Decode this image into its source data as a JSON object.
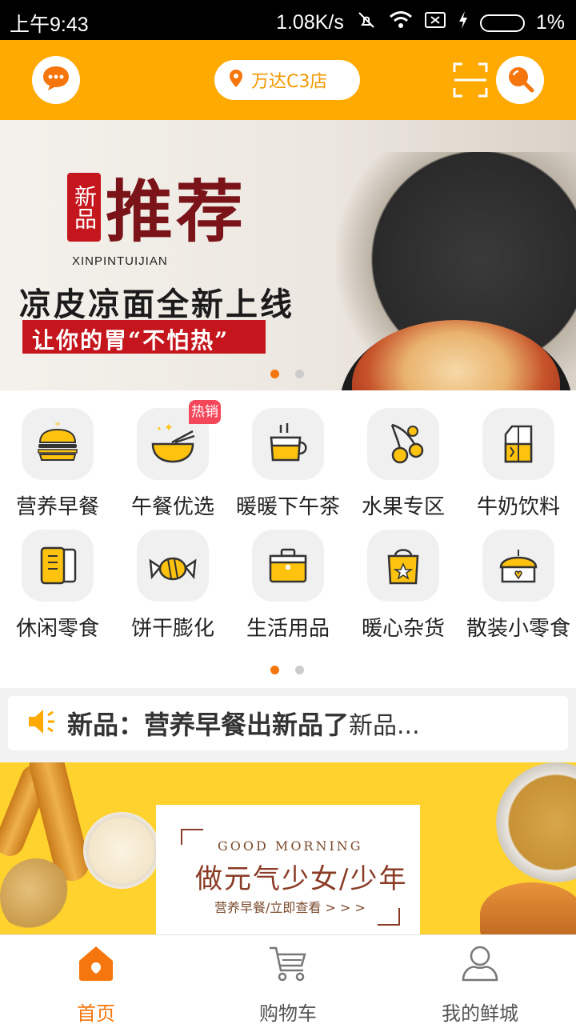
{
  "status_bar": {
    "time": "上午9:43",
    "net_speed": "1.08K/s",
    "battery": "1%"
  },
  "header": {
    "location": "万达C3店",
    "icons": [
      "chat-icon",
      "location-pin-icon",
      "scan-icon",
      "search-icon"
    ]
  },
  "banner": {
    "stamp": "新品",
    "headline": "推荐",
    "pinyin": "XINPINTUIJIAN",
    "slogan1": "凉皮凉面全新上线",
    "slogan2": "让你的胃“不怕热”",
    "pages": 2,
    "active_page": 1
  },
  "categories": {
    "hot_badge": "热销",
    "items": [
      {
        "label": "营养早餐",
        "icon": "burger-icon"
      },
      {
        "label": "午餐优选",
        "icon": "bowl-icon"
      },
      {
        "label": "暖暖下午茶",
        "icon": "tea-cup-icon"
      },
      {
        "label": "水果专区",
        "icon": "cherry-icon"
      },
      {
        "label": "牛奶饮料",
        "icon": "milk-carton-icon"
      },
      {
        "label": "休闲零食",
        "icon": "snack-bag-icon"
      },
      {
        "label": "饼干膨化",
        "icon": "candy-icon"
      },
      {
        "label": "生活用品",
        "icon": "first-aid-box-icon"
      },
      {
        "label": "暖心杂货",
        "icon": "shopping-bag-icon"
      },
      {
        "label": "散装小零食",
        "icon": "cake-icon"
      }
    ],
    "pages": 2,
    "active_page": 1
  },
  "notice": {
    "title": "新品：营养早餐出新品了",
    "more": "新品..."
  },
  "promo": {
    "eyebrow": "GOOD MORNING",
    "title": "做元气少女/少年",
    "link": "营养早餐/立即查看 > > >"
  },
  "tabs": [
    {
      "label": "首页",
      "icon": "home-icon",
      "active": true
    },
    {
      "label": "购物车",
      "icon": "cart-icon",
      "active": false
    },
    {
      "label": "我的鲜城",
      "icon": "user-icon",
      "active": false
    }
  ],
  "colors": {
    "brand": "#ffaa00",
    "accent": "#f5760c",
    "icon_yellow": "#ffc20e"
  }
}
